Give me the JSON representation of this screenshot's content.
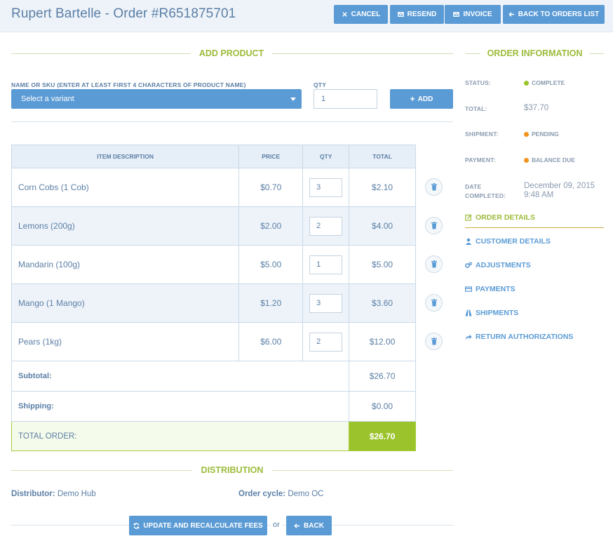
{
  "header": {
    "title": "Rupert Bartelle - Order #R651875701",
    "buttons": {
      "cancel": "CANCEL",
      "resend": "RESEND",
      "invoice": "INVOICE",
      "back_to_orders": "BACK TO ORDERS LIST"
    }
  },
  "add_product": {
    "section_title": "ADD PRODUCT",
    "name_label": "NAME OR SKU (ENTER AT LEAST FIRST 4 CHARACTERS OF PRODUCT NAME)",
    "variant_placeholder": "Select a variant",
    "qty_label": "QTY",
    "qty_value": "1",
    "add_label": "ADD"
  },
  "table": {
    "headers": [
      "ITEM DESCRIPTION",
      "PRICE",
      "QTY",
      "TOTAL"
    ],
    "rows": [
      {
        "desc": "Corn Cobs (1 Cob)",
        "price": "$0.70",
        "qty": "3",
        "total": "$2.10"
      },
      {
        "desc": "Lemons (200g)",
        "price": "$2.00",
        "qty": "2",
        "total": "$4.00"
      },
      {
        "desc": "Mandarin (100g)",
        "price": "$5.00",
        "qty": "1",
        "total": "$5.00"
      },
      {
        "desc": "Mango (1 Mango)",
        "price": "$1.20",
        "qty": "3",
        "total": "$3.60"
      },
      {
        "desc": "Pears (1kg)",
        "price": "$6.00",
        "qty": "2",
        "total": "$12.00"
      }
    ],
    "subtotal_label": "Subtotal:",
    "subtotal_value": "$26.70",
    "shipping_label": "Shipping:",
    "shipping_value": "$0.00",
    "total_label": "TOTAL ORDER:",
    "total_value": "$26.70"
  },
  "order_info": {
    "section_title": "ORDER INFORMATION",
    "status_label": "STATUS:",
    "status_value": "COMPLETE",
    "total_label": "TOTAL:",
    "total_value": "$37.70",
    "shipment_label": "SHIPMENT:",
    "shipment_value": "PENDING",
    "payment_label": "PAYMENT:",
    "payment_value": "BALANCE DUE",
    "date_label_1": "DATE",
    "date_label_2": "COMPLETED:",
    "date_value_1": "December 09, 2015",
    "date_value_2": "9:48 AM",
    "nav": {
      "order_details": "ORDER DETAILS",
      "customer_details": "CUSTOMER DETAILS",
      "adjustments": "ADJUSTMENTS",
      "payments": "PAYMENTS",
      "shipments": "SHIPMENTS",
      "return_authorizations": "RETURN AUTHORIZATIONS"
    }
  },
  "distribution": {
    "section_title": "DISTRIBUTION",
    "distributor_label": "Distributor:",
    "distributor_value": "Demo Hub",
    "order_cycle_label": "Order cycle:",
    "order_cycle_value": "Demo OC"
  },
  "footer": {
    "update_label": "UPDATE AND RECALCULATE FEES",
    "or_text": "or",
    "back_label": "BACK"
  },
  "colors": {
    "accent_blue": "#5b9bd5",
    "accent_green": "#9bc32c",
    "status_complete": "#9bc32c",
    "status_pending": "#f0941e"
  }
}
